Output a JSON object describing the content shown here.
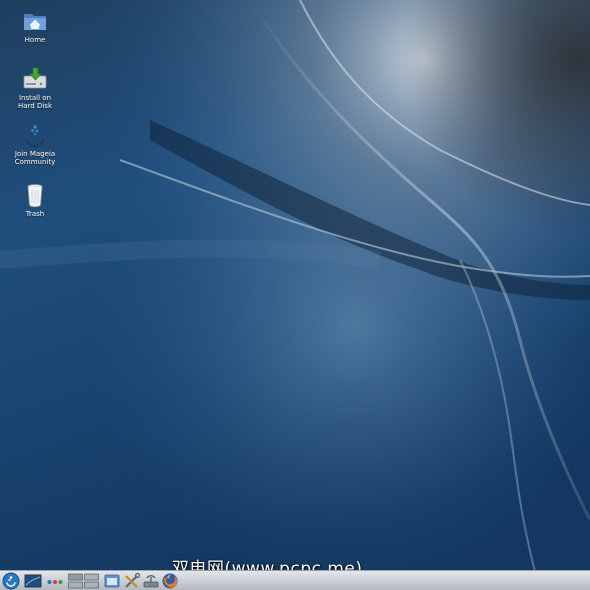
{
  "desktop": {
    "icons": [
      {
        "id": "home",
        "label": "Home",
        "icon": "home-folder-icon"
      },
      {
        "id": "install",
        "label": "Install on Hard Disk",
        "label_lines": [
          "Install on",
          "Hard Disk"
        ],
        "icon": "install-disk-icon"
      },
      {
        "id": "community",
        "label": "Join Mageia Community",
        "label_lines": [
          "Join Mageia",
          "Community"
        ],
        "icon": "mageia-logo-icon"
      },
      {
        "id": "trash",
        "label": "Trash",
        "icon": "trash-icon"
      }
    ]
  },
  "watermark": {
    "text": "双电网(www.pcpc.me)"
  },
  "taskbar": {
    "items": [
      {
        "id": "start-menu",
        "icon": "mageia-menu-icon"
      },
      {
        "id": "show-desktop",
        "icon": "show-desktop-icon"
      },
      {
        "id": "activities",
        "icon": "three-dots-icon"
      },
      {
        "id": "pager-desktop-1",
        "icon": "pager-icon"
      },
      {
        "id": "pager-desktop-2",
        "icon": "pager-icon"
      },
      {
        "id": "file-manager",
        "icon": "file-manager-icon"
      },
      {
        "id": "system-settings",
        "icon": "tools-icon"
      },
      {
        "id": "network",
        "icon": "network-icon"
      },
      {
        "id": "firefox",
        "icon": "firefox-icon"
      }
    ]
  },
  "colors": {
    "wallpaper_dark": "#133760",
    "wallpaper_mid": "#2d5f8f",
    "wallpaper_light": "#c7cfd6",
    "taskbar_bg": "#c8ccd3"
  }
}
